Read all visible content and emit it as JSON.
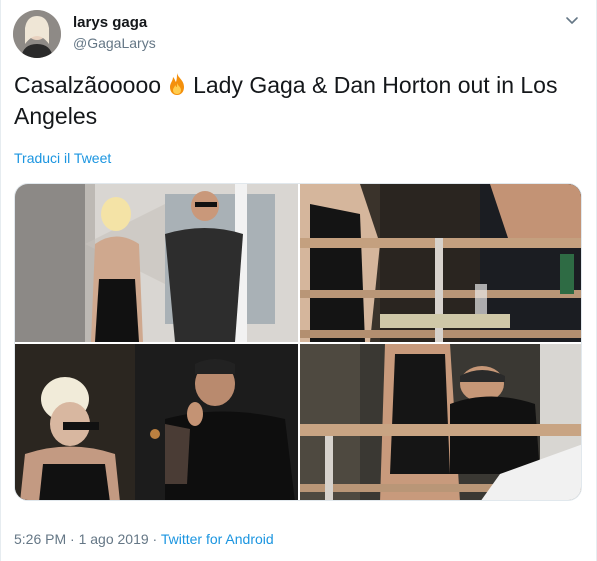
{
  "tweet": {
    "display_name": "larys gaga",
    "username": "@GagaLarys",
    "text_before": "Casalzãooooo",
    "text_after": "Lady Gaga & Dan Horton out in Los Angeles",
    "translate_label": "Traduci il Tweet",
    "timestamp": "5:26 PM · 1 ago 2019",
    "separator": " · ",
    "source": "Twitter for Android"
  },
  "icons": {
    "menu": "chevron-down-icon",
    "emoji": "fire-icon"
  },
  "colors": {
    "link": "#1b95e0",
    "secondary_text": "#657786",
    "primary_text": "#14171a"
  }
}
